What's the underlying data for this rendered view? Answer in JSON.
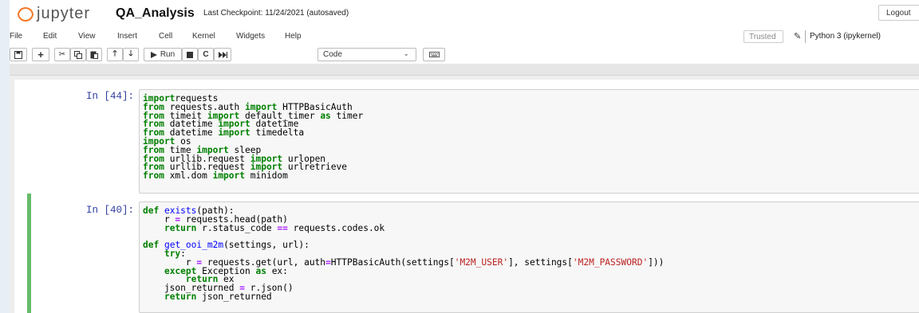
{
  "header": {
    "logo_text": "jupyter",
    "notebook_title": "QA_Analysis",
    "checkpoint": "Last Checkpoint: 11/24/2021  (autosaved)",
    "logout_label": "Logout"
  },
  "menubar": {
    "items": [
      "File",
      "Edit",
      "View",
      "Insert",
      "Cell",
      "Kernel",
      "Widgets",
      "Help"
    ],
    "trusted_label": "Trusted",
    "kernel_name": "Python 3 (ipykernel)"
  },
  "toolbar": {
    "run_label": "Run",
    "cell_type": "Code",
    "icons": [
      "save-icon",
      "plus-icon",
      "cut-icon",
      "copy-icon",
      "paste-icon",
      "arrow-up-icon",
      "arrow-down-icon",
      "run-icon",
      "stop-icon",
      "restart-icon",
      "fast-forward-icon",
      "keyboard-icon"
    ]
  },
  "cells": [
    {
      "prompt": "In [44]:",
      "selected": false,
      "lines": [
        [
          [
            "kw",
            "import"
          ],
          [
            "",
            "requests"
          ]
        ],
        [
          [
            "kw",
            "from"
          ],
          [
            "",
            " requests.auth "
          ],
          [
            "kw",
            "import"
          ],
          [
            "",
            " HTTPBasicAuth"
          ]
        ],
        [
          [
            "kw",
            "from"
          ],
          [
            "",
            " timeit "
          ],
          [
            "kw",
            "import"
          ],
          [
            "",
            " default_timer "
          ],
          [
            "kw",
            "as"
          ],
          [
            "",
            " timer"
          ]
        ],
        [
          [
            "kw",
            "from"
          ],
          [
            "",
            " datetime "
          ],
          [
            "kw",
            "import"
          ],
          [
            "",
            " datetime"
          ]
        ],
        [
          [
            "kw",
            "from"
          ],
          [
            "",
            " datetime "
          ],
          [
            "kw",
            "import"
          ],
          [
            "",
            " timedelta"
          ]
        ],
        [
          [
            "kw",
            "import"
          ],
          [
            "",
            " os"
          ]
        ],
        [
          [
            "kw",
            "from"
          ],
          [
            "",
            " time "
          ],
          [
            "kw",
            "import"
          ],
          [
            "",
            " sleep"
          ]
        ],
        [
          [
            "kw",
            "from"
          ],
          [
            "",
            " urllib.request "
          ],
          [
            "kw",
            "import"
          ],
          [
            "",
            " urlopen"
          ]
        ],
        [
          [
            "kw",
            "from"
          ],
          [
            "",
            " urllib.request "
          ],
          [
            "kw",
            "import"
          ],
          [
            "",
            " urlretrieve"
          ]
        ],
        [
          [
            "kw",
            "from"
          ],
          [
            "",
            " xml.dom "
          ],
          [
            "kw",
            "import"
          ],
          [
            "",
            " minidom"
          ]
        ]
      ]
    },
    {
      "prompt": "In [40]:",
      "selected": true,
      "lines": [
        [
          [
            "kw",
            "def"
          ],
          [
            "",
            " "
          ],
          [
            "fn",
            "exists"
          ],
          [
            "",
            "(path):"
          ]
        ],
        [
          [
            "",
            "    r "
          ],
          [
            "op",
            "="
          ],
          [
            "",
            " requests.head(path)"
          ]
        ],
        [
          [
            "",
            "    "
          ],
          [
            "kw",
            "return"
          ],
          [
            "",
            " r.status_code "
          ],
          [
            "op",
            "=="
          ],
          [
            "",
            " requests.codes.ok"
          ]
        ],
        [],
        [
          [
            "kw",
            "def"
          ],
          [
            "",
            " "
          ],
          [
            "fn",
            "get_ooi_m2m"
          ],
          [
            "",
            "(settings, url):"
          ]
        ],
        [
          [
            "",
            "    "
          ],
          [
            "kw",
            "try"
          ],
          [
            "",
            ":"
          ]
        ],
        [
          [
            "",
            "        r "
          ],
          [
            "op",
            "="
          ],
          [
            "",
            " requests.get(url, auth"
          ],
          [
            "op",
            "="
          ],
          [
            "",
            "HTTPBasicAuth(settings["
          ],
          [
            "st",
            "'M2M_USER'"
          ],
          [
            "",
            "], settings["
          ],
          [
            "st",
            "'M2M_PASSWORD'"
          ],
          [
            "",
            "]))"
          ]
        ],
        [
          [
            "",
            "    "
          ],
          [
            "kw",
            "except"
          ],
          [
            "",
            " Exception "
          ],
          [
            "kw",
            "as"
          ],
          [
            "",
            " ex:"
          ]
        ],
        [
          [
            "",
            "        "
          ],
          [
            "kw",
            "return"
          ],
          [
            "",
            " ex"
          ]
        ],
        [
          [
            "",
            "    json_returned "
          ],
          [
            "op",
            "="
          ],
          [
            "",
            " r.json()"
          ]
        ],
        [
          [
            "",
            "    "
          ],
          [
            "kw",
            "return"
          ],
          [
            "",
            " json_returned"
          ]
        ]
      ]
    }
  ],
  "colors": {
    "logo_orange": "#f37726",
    "prompt_blue": "#303f9f",
    "keyword_green": "#008000",
    "selected_border": "#66bb6a",
    "string_red": "#ba2121"
  }
}
